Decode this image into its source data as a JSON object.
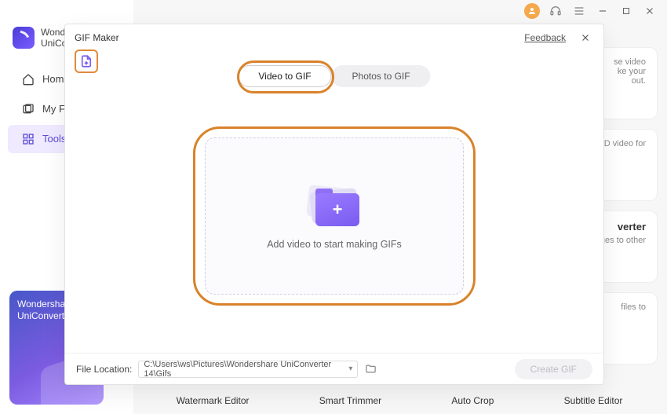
{
  "titlebar": {
    "avatar_initial": "•"
  },
  "brand": {
    "line1": "Wonde",
    "line2": "UniCo"
  },
  "sidebar": {
    "items": [
      {
        "label": "Home"
      },
      {
        "label": "My Fil"
      },
      {
        "label": "Tools"
      }
    ]
  },
  "promo": {
    "line1": "Wondersha",
    "line2": "UniConvert"
  },
  "bg_cards": [
    {
      "title": "",
      "desc": "se video\nke your\nout."
    },
    {
      "title": "",
      "desc": "D video for"
    },
    {
      "title": "verter",
      "desc": "ges to other"
    },
    {
      "title": "",
      "desc": "files to"
    }
  ],
  "tool_row": [
    "Watermark Editor",
    "Smart Trimmer",
    "Auto Crop",
    "Subtitle Editor"
  ],
  "modal": {
    "title": "GIF Maker",
    "feedback": "Feedback",
    "tabs": {
      "video": "Video to GIF",
      "photos": "Photos to GIF"
    },
    "drop_text": "Add video to start making GIFs",
    "footer": {
      "label": "File Location:",
      "path": "C:\\Users\\ws\\Pictures\\Wondershare UniConverter 14\\Gifs",
      "create": "Create GIF"
    }
  }
}
